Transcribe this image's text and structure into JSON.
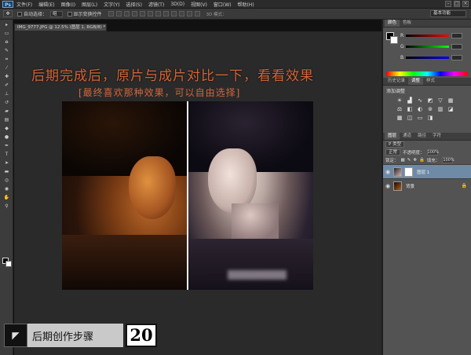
{
  "menubar": {
    "logo": "Ps",
    "items": [
      "文件(F)",
      "编辑(E)",
      "图像(I)",
      "图层(L)",
      "文字(Y)",
      "选择(S)",
      "滤镜(T)",
      "3D(D)",
      "视图(V)",
      "窗口(W)",
      "帮助(H)"
    ],
    "window_buttons": [
      "–",
      "□",
      "×"
    ]
  },
  "optbar": {
    "auto_select_label": "自动选择：",
    "auto_select_value": "组",
    "show_transform_label": "显示变换控件",
    "mode_3d_label": "3D 模式：",
    "workspace": "基本功能"
  },
  "document": {
    "tab_title": "IMG_9777.JPG @ 12.5% (图层 1, RGB/8) *"
  },
  "canvas": {
    "headline": "后期完成后，原片与成片对比一下，看看效果",
    "subline": "[最终喜欢那种效果，可以自由选择]"
  },
  "step": {
    "label": "后期创作步骤",
    "number": "20"
  },
  "panels": {
    "color_tabs": [
      "颜色",
      "色板"
    ],
    "color_channels": [
      "R",
      "G",
      "B"
    ],
    "adjust_tabs": [
      "历史记录",
      "调整",
      "样式"
    ],
    "adjust_title": "添加调整",
    "layers_tabs": [
      "图层",
      "通道",
      "路径",
      "字符"
    ],
    "kind_label": "P 类型",
    "blend_mode": "正常",
    "opacity_label": "不透明度：",
    "opacity_value": "100%",
    "lock_label": "锁定：",
    "fill_label": "填充：",
    "fill_value": "100%",
    "layers": [
      {
        "name": "图层 1"
      },
      {
        "name": "背景"
      }
    ]
  },
  "colors": {
    "headline": "#d3663a",
    "selected_layer": "#6f8aa6"
  }
}
